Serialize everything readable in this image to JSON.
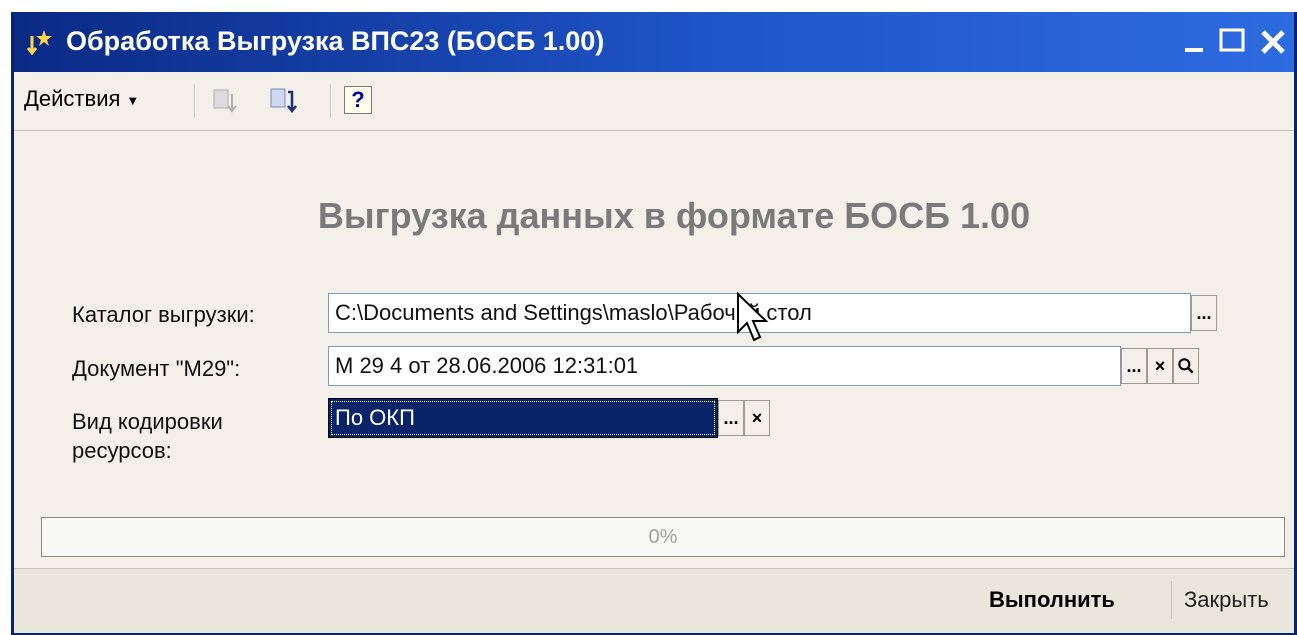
{
  "window": {
    "title": "Обработка  Выгрузка ВПС23 (БОСБ 1.00)",
    "controls": [
      "minimize-icon",
      "maximize-icon",
      "close-icon"
    ]
  },
  "toolbar": {
    "actions_label": "Действия",
    "help_label": "?"
  },
  "form": {
    "heading": "Выгрузка данных в формате БОСБ 1.00",
    "catalog": {
      "label": "Каталог выгрузки:",
      "value": "C:\\Documents and Settings\\maslo\\Рабочий стол"
    },
    "document": {
      "label": "Документ \"М29\":",
      "value": "М 29 4 от 28.06.2006 12:31:01"
    },
    "encoding": {
      "label_line1": "Вид кодировки",
      "label_line2": "ресурсов:",
      "value": "По  ОКП"
    },
    "ellipsis": "...",
    "clear": "×"
  },
  "progress": {
    "text": "0%",
    "value": 0
  },
  "buttons": {
    "run": "Выполнить",
    "close": "Закрыть"
  },
  "colors": {
    "title_gradient_start": "#0a2a84",
    "title_gradient_end": "#2d6be0",
    "selection": "#0a246a",
    "window_bg": "#f2f0e9"
  }
}
